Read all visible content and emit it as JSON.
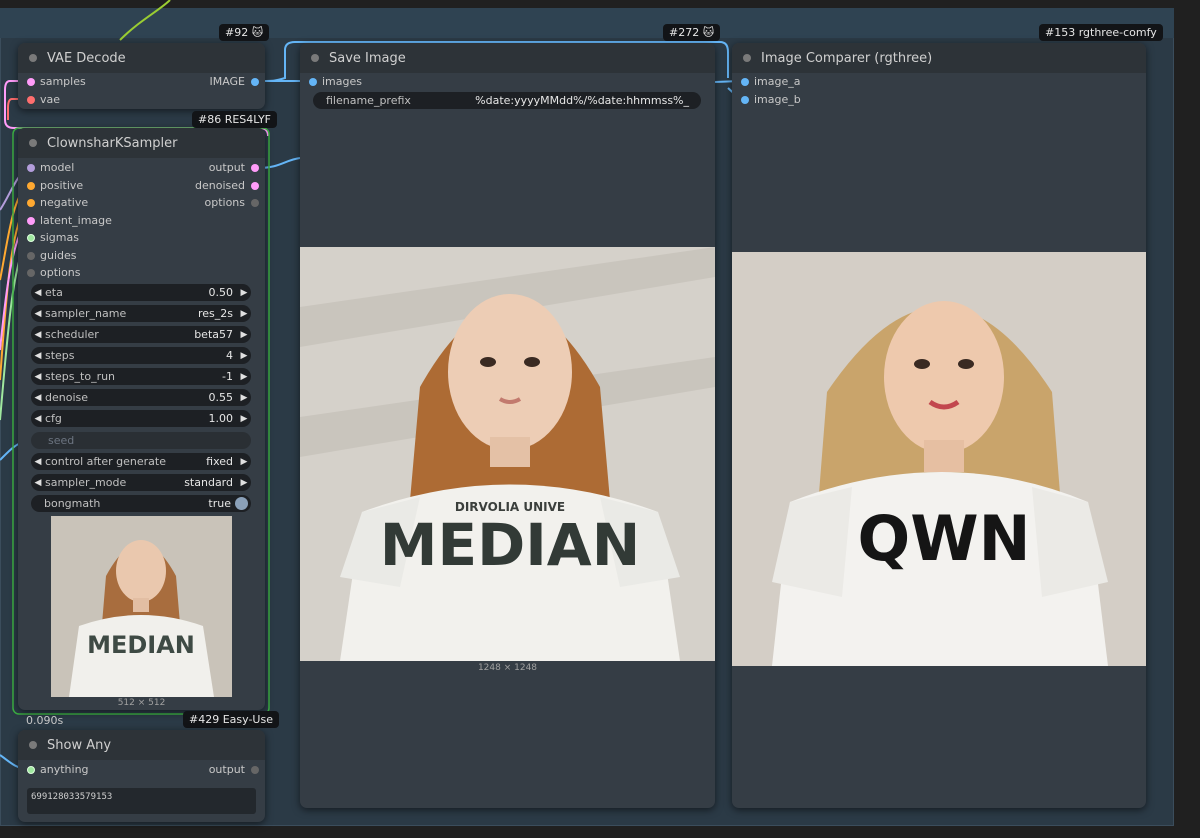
{
  "nodes": {
    "vae_decode": {
      "title": "VAE Decode",
      "badge": "#92 🐱",
      "inputs": [
        "samples",
        "vae"
      ],
      "output": "IMAGE"
    },
    "sampler": {
      "title": "ClownsharKSampler",
      "badge": "#86 RES4LYF",
      "inputs": [
        "model",
        "positive",
        "negative",
        "latent_image",
        "sigmas",
        "guides",
        "options"
      ],
      "outputs": [
        "output",
        "denoised",
        "options"
      ],
      "widgets": [
        {
          "label": "eta",
          "value": "0.50"
        },
        {
          "label": "sampler_name",
          "value": "res_2s"
        },
        {
          "label": "scheduler",
          "value": "beta57"
        },
        {
          "label": "steps",
          "value": "4"
        },
        {
          "label": "steps_to_run",
          "value": "-1"
        },
        {
          "label": "denoise",
          "value": "0.55"
        },
        {
          "label": "cfg",
          "value": "1.00"
        },
        {
          "label": "seed",
          "value": ""
        },
        {
          "label": "control after generate",
          "value": "fixed"
        },
        {
          "label": "sampler_mode",
          "value": "standard"
        }
      ],
      "bongmath": {
        "label": "bongmath",
        "value": "true"
      },
      "preview_size": "512 × 512"
    },
    "save_image": {
      "title": "Save Image",
      "badge": "#272 🐱",
      "input": "images",
      "widget": {
        "label": "filename_prefix",
        "value": "%date:yyyyMMdd%/%date:hhmmss%_"
      },
      "image_size": "1248 × 1248",
      "shirt_text": "MEDIAN",
      "shirt_subtext": "DIRVOLIA UNIVE"
    },
    "comparer": {
      "title": "Image Comparer (rgthree)",
      "badge": "#153 rgthree-comfy",
      "inputs": [
        "image_a",
        "image_b"
      ],
      "shirt_text": "QWN"
    },
    "show_any": {
      "title": "Show Any",
      "badge": "#429 Easy-Use",
      "timing": "0.090s",
      "input": "anything",
      "output": "output",
      "text": "699128033579153"
    }
  },
  "colors": {
    "image": "#64b5f6",
    "latent": "#ff9cf9",
    "vae": "#ff6e6e",
    "model": "#b39ddb",
    "conditioning": "#ffa931",
    "sigmas": "#9fe89f",
    "other": "#666666",
    "group": "#2b3a46"
  }
}
